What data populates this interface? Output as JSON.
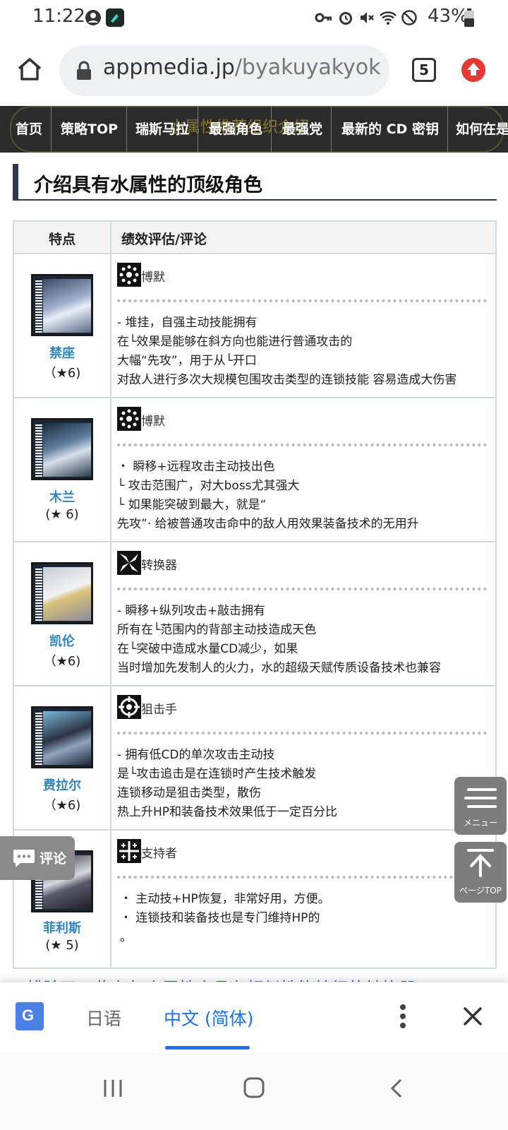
{
  "status_bar": {
    "time": "11:22",
    "battery": "43%"
  },
  "browser": {
    "url_host": "appmedia.jp",
    "url_path": "/byakuyakyokko/",
    "tab_count": "5"
  },
  "site_nav": {
    "ghost_title": "水属性推荐组织介绍",
    "items": [
      "首页",
      "策略TOP",
      "瑞斯马拉",
      "最强角色",
      "最强党",
      "最新的 CD 密钥",
      "如何在是"
    ]
  },
  "section": {
    "heading": "介绍具有水属性的顶级角色"
  },
  "table": {
    "headers": [
      "特点",
      "绩效评估/评论"
    ],
    "rows": [
      {
        "name": "禁座",
        "rarity": "（★6)",
        "role": "博默",
        "desc": "- 堆挂，自强主动技能拥有\n在└效果是能够在斜方向也能进行普通攻击的\n大幅“先攻”，用于从└开口\n对敌人进行多次大规模包围攻击类型的连锁技能 容易造成大伤害"
      },
      {
        "name": "木兰",
        "rarity": "(★ 6)",
        "role": "博默",
        "desc": "・ 瞬移+远程攻击主动技出色\n└ 攻击范围广，对大boss尤其强大\n└ 如果能突破到最大，就是“\n先攻”· 给被普通攻击命中的敌人用效果装备技术的无用升"
      },
      {
        "name": "凯伦",
        "rarity": "（★6)",
        "role": "转换器",
        "desc": "- 瞬移+纵列攻击+敲击拥有\n所有在└范围内的背部主动技造成天色\n在└突破中造成水量CD减少，如果\n当时增加先发制人的火力，水的超级天赋传质设备技术也兼容"
      },
      {
        "name": "费拉尔",
        "rarity": "（★6)",
        "role": "狙击手",
        "desc": "- 拥有低CD的单次攻击主动技\n是└攻击追击是在连锁时产生技术触发\n连锁移动是狙击类型，散伤\n热上升HP和装备技术效果低于一定百分比"
      },
      {
        "name": "菲利斯",
        "rarity": "(★ 5)",
        "role": "支持者",
        "desc": "・ 主动技+HP恢复，非常好用，方便。\n・ 连锁技和装备技也是专门维持HP的\n。"
      }
    ]
  },
  "footnote": "* 排除了一些在每个属性中具有相似性能特征的转换器",
  "floating": {
    "menu": "メニュー",
    "top": "ページTOP",
    "comment": "评论"
  },
  "translate_bar": {
    "source_lang": "日语",
    "target_lang": "中文 (简体)"
  }
}
